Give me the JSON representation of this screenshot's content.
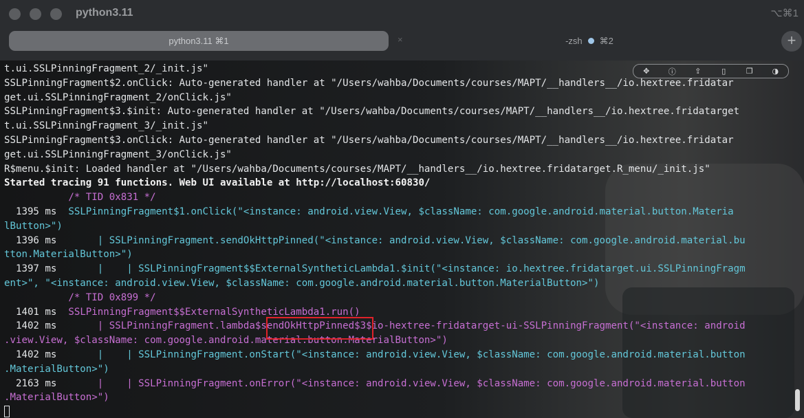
{
  "window": {
    "title": "python3.11",
    "shortcut": "⌥⌘1"
  },
  "tabs": [
    {
      "label": "python3.11 ⌘1",
      "active": true
    },
    {
      "label": "-zsh",
      "shortcut": "⌘2",
      "active": false
    }
  ],
  "tab_close_glyph": "×",
  "new_tab_glyph": "+",
  "toolbar_icons": [
    "move-icon",
    "info-icon",
    "share-icon",
    "bookmark-icon",
    "copy-icon",
    "palette-icon"
  ],
  "toolbar_glyphs": [
    "✥",
    "ⓘ",
    "⇪",
    "▯",
    "❐",
    "◑"
  ],
  "terminal": {
    "lines": [
      [
        {
          "t": "t.ui.SSLPinningFragment_2/_init.js\""
        }
      ],
      [
        {
          "t": "SSLPinningFragment$2.onClick: Auto-generated handler at \"/Users/wahba/Documents/courses/MAPT/__handlers__/io.hextree.fridatar"
        }
      ],
      [
        {
          "t": "get.ui.SSLPinningFragment_2/onClick.js\""
        }
      ],
      [
        {
          "t": "SSLPinningFragment$3.$init: Auto-generated handler at \"/Users/wahba/Documents/courses/MAPT/__handlers__/io.hextree.fridatarget"
        }
      ],
      [
        {
          "t": "t.ui.SSLPinningFragment_3/_init.js\""
        }
      ],
      [
        {
          "t": "SSLPinningFragment$3.onClick: Auto-generated handler at \"/Users/wahba/Documents/courses/MAPT/__handlers__/io.hextree.fridatar"
        }
      ],
      [
        {
          "t": "get.ui.SSLPinningFragment_3/onClick.js\""
        }
      ],
      [
        {
          "t": "R$menu.$init: Loaded handler at \"/Users/wahba/Documents/courses/MAPT/__handlers__/io.hextree.fridatarget.R_menu/_init.js\""
        }
      ],
      [
        {
          "t": "Started tracing 91 functions. Web UI available at http://localhost:60830/",
          "c": "bold"
        }
      ],
      [
        {
          "t": "           /* TID 0x831 */",
          "c": "pink"
        }
      ],
      [
        {
          "t": "  1395 ms  ",
          "c": "ms"
        },
        {
          "t": "SSLPinningFragment$1.onClick(\"<instance: android.view.View, $className: com.google.android.material.button.Materia",
          "c": "cyan"
        }
      ],
      [
        {
          "t": "lButton>\")",
          "c": "cyan"
        }
      ],
      [
        {
          "t": "  1396 ms  ",
          "c": "ms"
        },
        {
          "t": "     | SSLPinningFragment.sendOkHttpPinned(\"<instance: android.view.View, $className: com.google.android.material.bu",
          "c": "cyan"
        }
      ],
      [
        {
          "t": "tton.MaterialButton>\")",
          "c": "cyan"
        }
      ],
      [
        {
          "t": "  1397 ms  ",
          "c": "ms"
        },
        {
          "t": "     |    | SSLPinningFragment$$ExternalSyntheticLambda1.$init(\"<instance: io.hextree.fridatarget.ui.SSLPinningFragm",
          "c": "cyan"
        }
      ],
      [
        {
          "t": "ent>\", \"<instance: android.view.View, $className: com.google.android.material.button.MaterialButton>\")",
          "c": "cyan"
        }
      ],
      [
        {
          "t": "           /* TID 0x899 */",
          "c": "pink"
        }
      ],
      [
        {
          "t": "  1401 ms  ",
          "c": "ms"
        },
        {
          "t": "SSLPinningFragment$$ExternalSyntheticLambda1.run()",
          "c": "pink"
        }
      ],
      [
        {
          "t": "  1402 ms  ",
          "c": "ms"
        },
        {
          "t": "     | SSLPinningFragment.lambda$sendOkHttpPinned$3$io-hextree-fridatarget-ui-SSLPinningFragment(\"<instance: android",
          "c": "pink"
        }
      ],
      [
        {
          "t": ".view.View, $className: com.google.android.material.button.MaterialButton>\")",
          "c": "pink"
        }
      ],
      [
        {
          "t": "  1402 ms  ",
          "c": "ms"
        },
        {
          "t": "     |    | SSLPinningFragment.onStart(\"<instance: android.view.View, $className: com.google.android.material.button",
          "c": "cyan"
        }
      ],
      [
        {
          "t": ".MaterialButton>\")",
          "c": "cyan"
        }
      ],
      [
        {
          "t": "  2163 ms  ",
          "c": "ms"
        },
        {
          "t": "     |    | SSLPinningFragment.onError(\"<instance: android.view.View, $className: com.google.android.material.button",
          "c": "pink"
        }
      ],
      [
        {
          "t": ".MaterialButton>\")",
          "c": "pink"
        }
      ]
    ]
  },
  "colors": {
    "cyan": "#63c7d9",
    "pink": "#c76fd3",
    "highlight": "#e0222a"
  }
}
